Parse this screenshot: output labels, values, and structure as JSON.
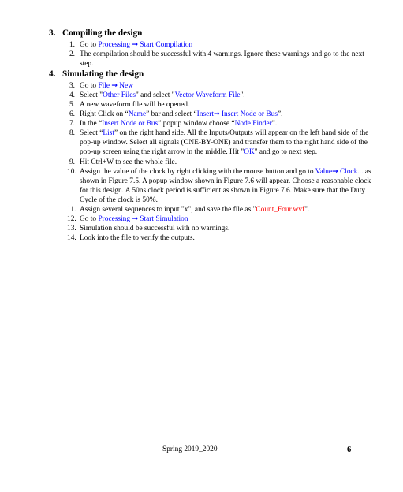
{
  "document": {
    "sections": [
      {
        "number": "3.",
        "title": "Compiling the design",
        "items": [
          {
            "number": "1.",
            "runs": [
              {
                "text": "Go to ",
                "color": "black"
              },
              {
                "text": "Processing ",
                "color": "blue"
              },
              {
                "text": "→",
                "color": "blue",
                "glyph": "arrow"
              },
              {
                "text": " Start Compilation",
                "color": "blue"
              }
            ]
          },
          {
            "number": "2.",
            "runs": [
              {
                "text": "The compilation should be successful with 4 warnings. Ignore these warnings and go to the next step.",
                "color": "black"
              }
            ]
          }
        ]
      },
      {
        "number": "4.",
        "title": "Simulating the design",
        "items": [
          {
            "number": "3.",
            "runs": [
              {
                "text": "Go to ",
                "color": "black"
              },
              {
                "text": "File ",
                "color": "blue"
              },
              {
                "text": "→",
                "color": "blue",
                "glyph": "arrow"
              },
              {
                "text": " New",
                "color": "blue"
              }
            ]
          },
          {
            "number": "4.",
            "runs": [
              {
                "text": "Select \"",
                "color": "black"
              },
              {
                "text": "Other Files",
                "color": "blue"
              },
              {
                "text": "\" and select \"",
                "color": "black"
              },
              {
                "text": "Vector Waveform File",
                "color": "blue"
              },
              {
                "text": "\".",
                "color": "black"
              }
            ]
          },
          {
            "number": "5.",
            "runs": [
              {
                "text": "A new waveform file will be opened.",
                "color": "black"
              }
            ]
          },
          {
            "number": "6.",
            "runs": [
              {
                "text": "Right Click on “",
                "color": "black"
              },
              {
                "text": "Name",
                "color": "blue"
              },
              {
                "text": "” bar and select “",
                "color": "black"
              },
              {
                "text": "Insert",
                "color": "blue"
              },
              {
                "text": "→",
                "color": "blue",
                "glyph": "arrow"
              },
              {
                "text": " Insert Node or Bus",
                "color": "blue"
              },
              {
                "text": "”.",
                "color": "black"
              }
            ]
          },
          {
            "number": "7.",
            "runs": [
              {
                "text": "In the “",
                "color": "black"
              },
              {
                "text": "Insert Node or Bus",
                "color": "blue"
              },
              {
                "text": "” popup window choose “",
                "color": "black"
              },
              {
                "text": "Node Finder",
                "color": "blue"
              },
              {
                "text": "”.",
                "color": "black"
              }
            ]
          },
          {
            "number": "8.",
            "runs": [
              {
                "text": "Select “",
                "color": "black"
              },
              {
                "text": "List",
                "color": "blue"
              },
              {
                "text": "” on the right hand side. All the Inputs/Outputs will appear on the left hand side of the pop-up window. Select all signals (ONE-BY-ONE) and transfer them to the right hand side of the pop-up screen using the right arrow in the middle. Hit \"",
                "color": "black"
              },
              {
                "text": "OK",
                "color": "blue"
              },
              {
                "text": "\" and go to next step.",
                "color": "black"
              }
            ]
          },
          {
            "number": "9.",
            "runs": [
              {
                "text": "Hit Ctrl+W to see the whole file.",
                "color": "black"
              }
            ]
          },
          {
            "number": "10.",
            "runs": [
              {
                "text": "Assign the value of the clock by right clicking with the mouse button and go to ",
                "color": "black"
              },
              {
                "text": "Value",
                "color": "blue"
              },
              {
                "text": "→",
                "color": "blue",
                "glyph": "arrow"
              },
              {
                "text": " Clock...",
                "color": "blue"
              },
              {
                "text": " as shown in Figure 7.5. A popup window shown in Figure 7.6 will appear. Choose a reasonable clock for this design. A 50ns clock period is sufficient as shown in Figure 7.6. Make sure that the Duty Cycle of the clock is 50%.",
                "color": "black"
              }
            ]
          },
          {
            "number": "11.",
            "runs": [
              {
                "text": "Assign several sequences to input \"x\", and save the file as \"",
                "color": "black"
              },
              {
                "text": "Count_Four.wvf",
                "color": "red"
              },
              {
                "text": "\".",
                "color": "black"
              }
            ]
          },
          {
            "number": "12.",
            "runs": [
              {
                "text": "Go to ",
                "color": "black"
              },
              {
                "text": "Processing ",
                "color": "blue"
              },
              {
                "text": "→",
                "color": "blue",
                "glyph": "arrow"
              },
              {
                "text": " Start Simulation",
                "color": "blue"
              }
            ]
          },
          {
            "number": "13.",
            "runs": [
              {
                "text": "Simulation should be successful with no warnings.",
                "color": "black"
              }
            ]
          },
          {
            "number": "14.",
            "runs": [
              {
                "text": "Look into the file to verify the outputs.",
                "color": "black"
              }
            ]
          }
        ]
      }
    ]
  },
  "footer": {
    "center": "Spring 2019_2020",
    "page_number": "6"
  },
  "colors": {
    "text": "#000000",
    "link_blue": "#0000ff",
    "highlight_red": "#ff0000",
    "background": "#ffffff"
  }
}
